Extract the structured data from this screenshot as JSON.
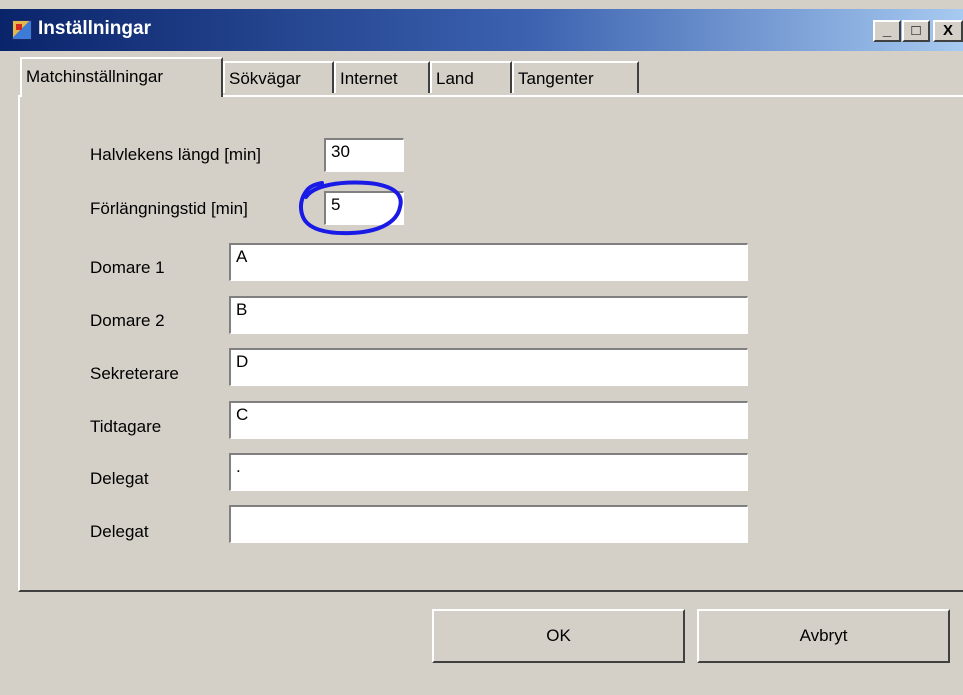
{
  "window": {
    "title": "Inställningar",
    "controls": {
      "minimize": "_",
      "maximize": "□",
      "close": "X"
    },
    "icon": "app-settings-icon"
  },
  "tabs": [
    {
      "label": "Matchinställningar",
      "active": true
    },
    {
      "label": "Sökvägar",
      "active": false
    },
    {
      "label": "Internet",
      "active": false
    },
    {
      "label": "Land",
      "active": false
    },
    {
      "label": "Tangenter",
      "active": false
    }
  ],
  "form": {
    "half_length": {
      "label": "Halvlekens längd [min]",
      "value": "30"
    },
    "extra_time": {
      "label": "Förlängningstid [min]",
      "value": "5"
    },
    "referee1": {
      "label": "Domare 1",
      "value": "A"
    },
    "referee2": {
      "label": "Domare 2",
      "value": "B"
    },
    "secretary": {
      "label": "Sekreterare",
      "value": "D"
    },
    "timekeeper": {
      "label": "Tidtagare",
      "value": "C"
    },
    "delegate1": {
      "label": "Delegat",
      "value": "."
    },
    "delegate2": {
      "label": "Delegat",
      "value": ""
    }
  },
  "buttons": {
    "ok": "OK",
    "cancel": "Avbryt"
  },
  "annotation": {
    "color": "#1a1ae6",
    "shape": "hand-drawn-circle"
  }
}
